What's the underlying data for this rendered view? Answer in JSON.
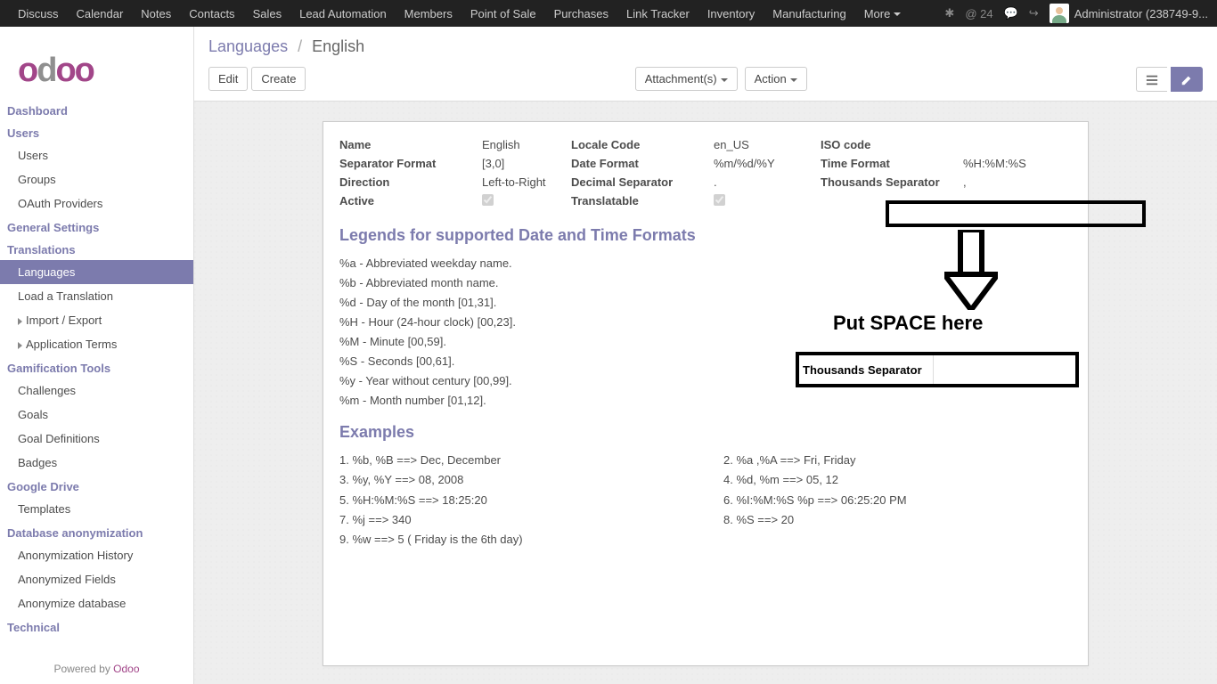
{
  "topnav": {
    "items": [
      "Discuss",
      "Calendar",
      "Notes",
      "Contacts",
      "Sales",
      "Lead Automation",
      "Members",
      "Point of Sale",
      "Purchases",
      "Link Tracker",
      "Inventory",
      "Manufacturing",
      "More"
    ],
    "mail_count": "@ 24",
    "user": "Administrator (238749-9..."
  },
  "sidebar": {
    "sections": {
      "dashboard": "Dashboard",
      "users": "Users",
      "users_items": [
        "Users",
        "Groups",
        "OAuth Providers"
      ],
      "general": "General Settings",
      "translations": "Translations",
      "translations_items": [
        "Languages",
        "Load a Translation",
        "Import / Export",
        "Application Terms"
      ],
      "gamification": "Gamification Tools",
      "gamification_items": [
        "Challenges",
        "Goals",
        "Goal Definitions",
        "Badges"
      ],
      "gdrive": "Google Drive",
      "gdrive_items": [
        "Templates"
      ],
      "anon": "Database anonymization",
      "anon_items": [
        "Anonymization History",
        "Anonymized Fields",
        "Anonymize database"
      ],
      "technical": "Technical"
    },
    "powered": "Powered by ",
    "powered_link": "Odoo"
  },
  "breadcrumb": {
    "root": "Languages",
    "current": "English"
  },
  "buttons": {
    "edit": "Edit",
    "create": "Create",
    "attach": "Attachment(s)",
    "action": "Action"
  },
  "fields": {
    "name_l": "Name",
    "name_v": "English",
    "locale_l": "Locale Code",
    "locale_v": "en_US",
    "iso_l": "ISO code",
    "iso_v": "",
    "sep_l": "Separator Format",
    "sep_v": "[3,0]",
    "date_l": "Date Format",
    "date_v": "%m/%d/%Y",
    "time_l": "Time Format",
    "time_v": "%H:%M:%S",
    "dir_l": "Direction",
    "dir_v": "Left-to-Right",
    "dec_l": "Decimal Separator",
    "dec_v": ".",
    "thou_l": "Thousands Separator",
    "thou_v": ",",
    "active_l": "Active",
    "trans_l": "Translatable"
  },
  "legends_title": "Legends for supported Date and Time Formats",
  "legends": [
    "%a - Abbreviated weekday name.",
    "%b - Abbreviated month name.",
    "%d - Day of the month [01,31].",
    "%H - Hour (24-hour clock) [00,23].",
    "%M - Minute [00,59].",
    "%S - Seconds [00,61].",
    "%y - Year without century [00,99].",
    "%m - Month number [01,12]."
  ],
  "examples_title": "Examples",
  "examples_left": [
    "1. %b, %B ==> Dec, December",
    "3. %y, %Y ==> 08, 2008",
    "5. %H:%M:%S ==> 18:25:20",
    "7. %j ==> 340",
    "9. %w ==> 5 ( Friday is the 6th day)"
  ],
  "examples_right": [
    "2. %a ,%A ==> Fri, Friday",
    "4. %d, %m ==> 05, 12",
    "6. %I:%M:%S %p ==> 06:25:20 PM",
    "8. %S ==> 20"
  ],
  "annotation": {
    "text": "Put SPACE here",
    "box2_label": "Thousands Separator"
  }
}
